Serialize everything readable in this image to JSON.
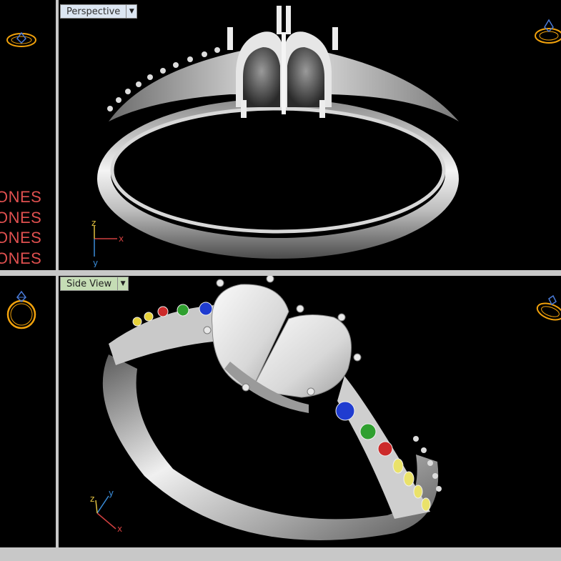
{
  "viewports": {
    "top": {
      "label": "Perspective",
      "dropdown_glyph": "▼"
    },
    "bottom": {
      "label": "Side View",
      "dropdown_glyph": "▼"
    }
  },
  "side_labels": [
    "ONES",
    "ONES",
    "ONES",
    "ONES"
  ],
  "axes": {
    "top": {
      "x": "x",
      "y": "y",
      "z": "z"
    },
    "bottom": {
      "x": "x",
      "y": "y",
      "z": "z"
    }
  },
  "colors": {
    "viewport_bg": "#000000",
    "frame": "#c8c8c8",
    "perspective_label_bg": "#dce6f2",
    "sideview_label_bg": "#c5ddb5",
    "stones_text": "#e0504f",
    "thumbnail_orange": "#f2a20c",
    "metal_light": "#f2f2f2",
    "metal_dark": "#5a5a5a"
  },
  "icons": [
    "ring-thumbnail-icon",
    "dropdown-arrow-icon",
    "axis-triad-icon"
  ]
}
